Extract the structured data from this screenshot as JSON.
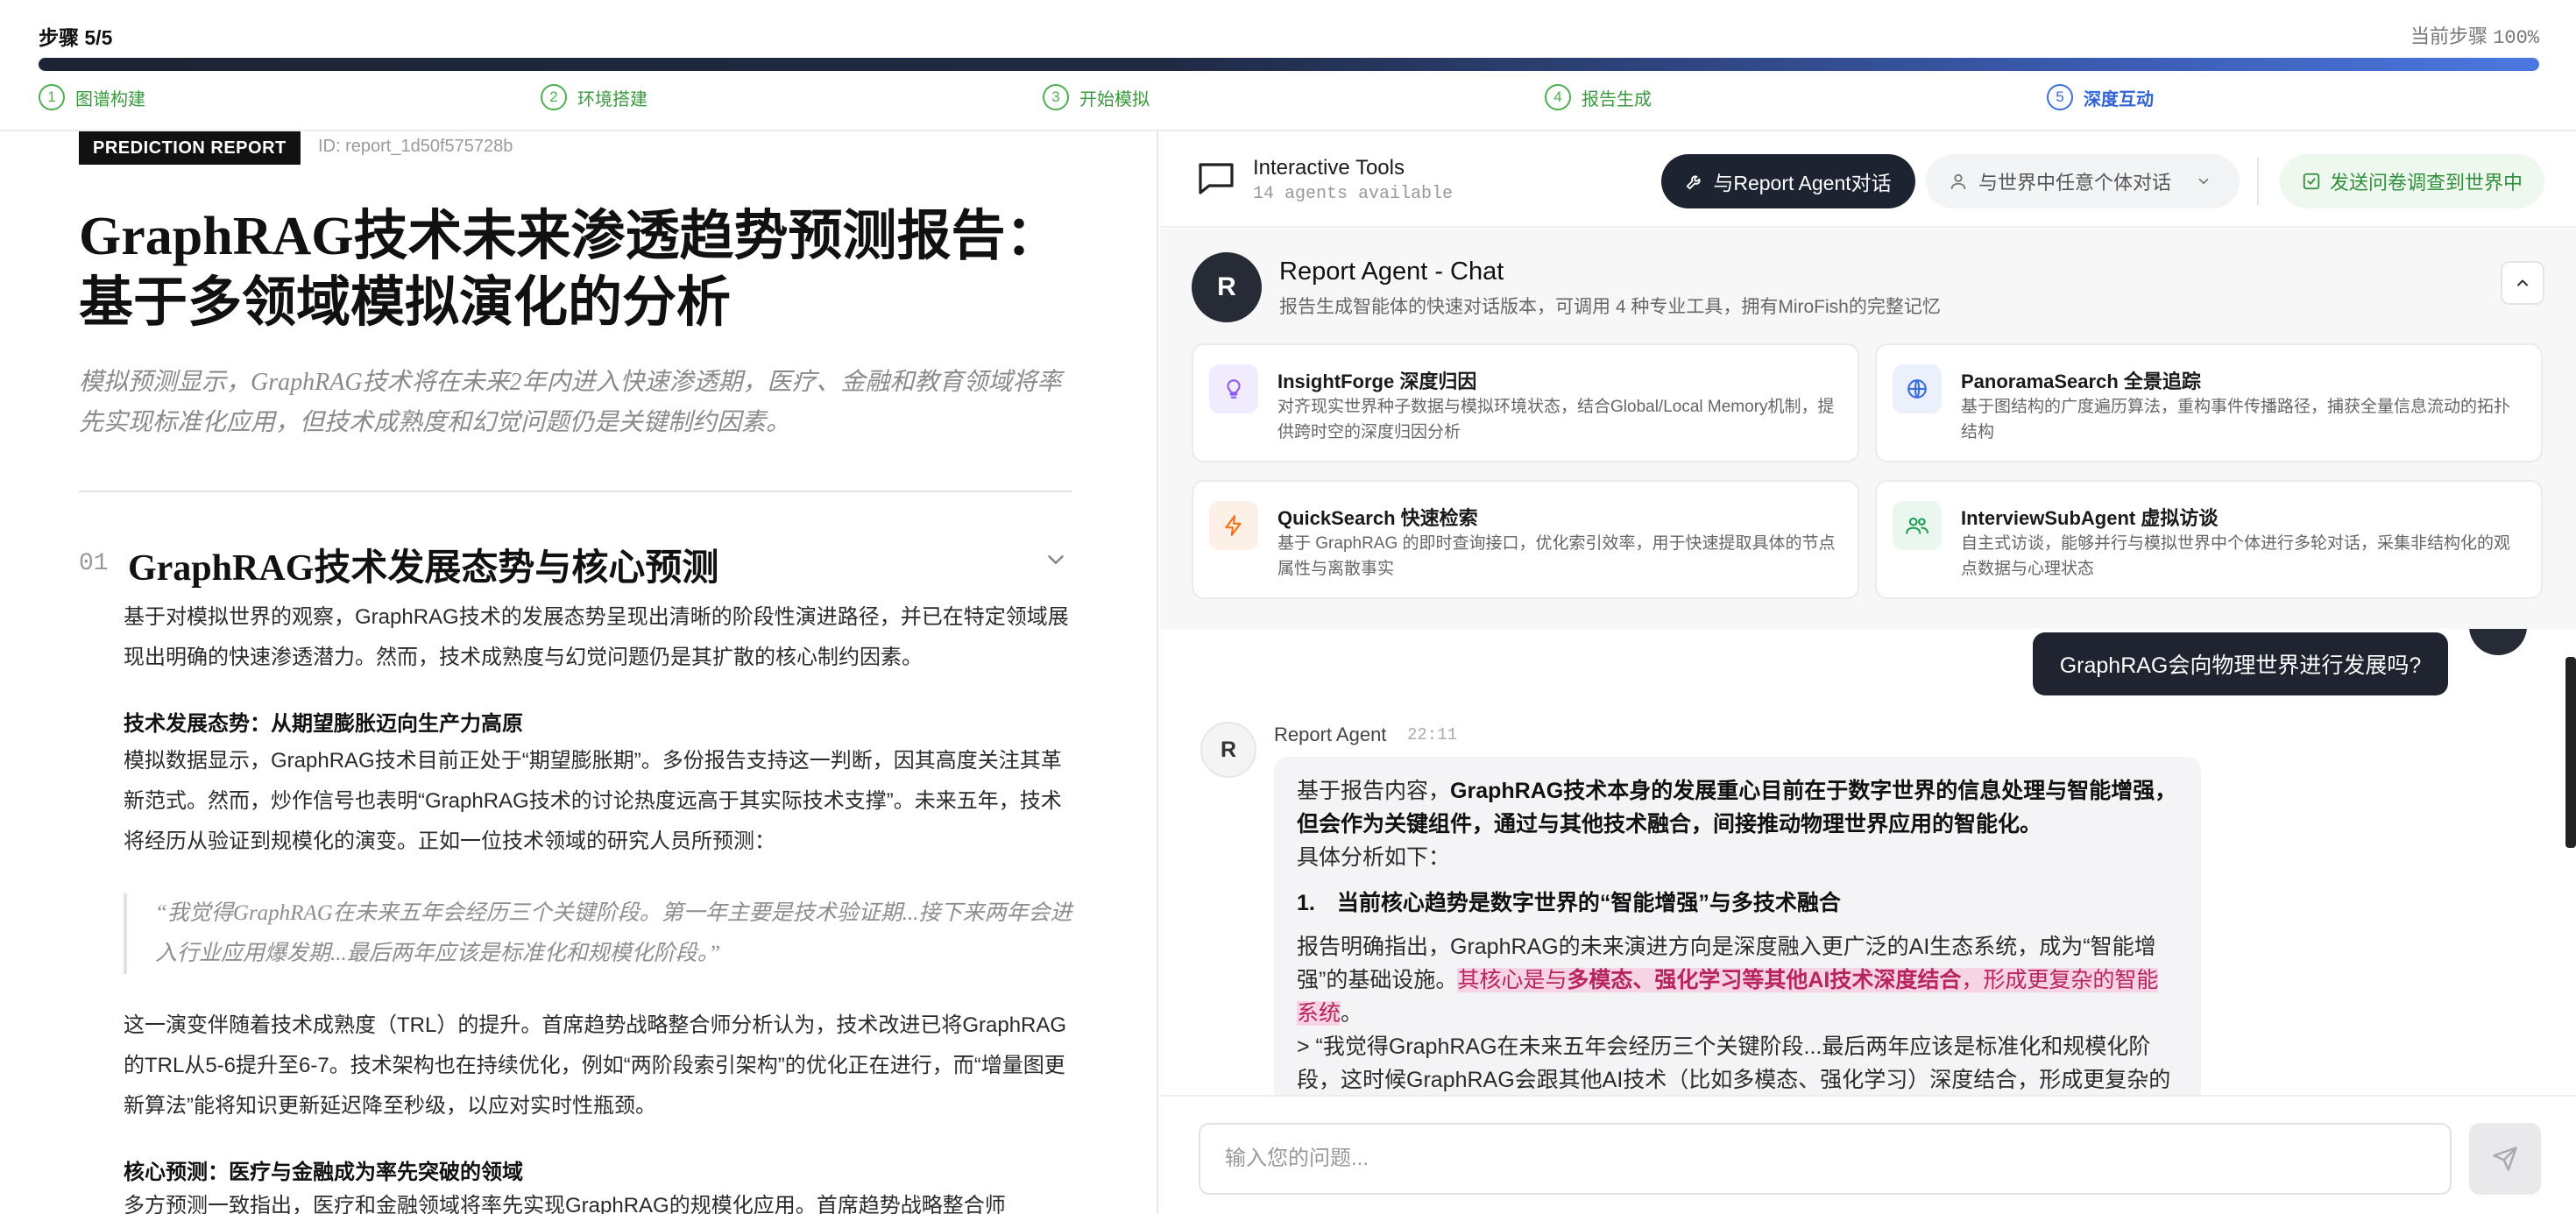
{
  "topbar": {
    "step_title": "步骤 5/5",
    "current_label": "当前步骤",
    "current_pct": "100%",
    "progress": 1.0,
    "steps": [
      {
        "num": "1",
        "label": "图谱构建"
      },
      {
        "num": "2",
        "label": "环境搭建"
      },
      {
        "num": "3",
        "label": "开始模拟"
      },
      {
        "num": "4",
        "label": "报告生成"
      },
      {
        "num": "5",
        "label": "深度互动"
      }
    ]
  },
  "report": {
    "tag": "PREDICTION REPORT",
    "id": "ID: report_1d50f575728b",
    "title": "GraphRAG技术未来渗透趋势预测报告：基于多领域模拟演化的分析",
    "summary": "模拟预测显示，GraphRAG技术将在未来2年内进入快速渗透期，医疗、金融和教育领域将率先实现标准化应用，但技术成熟度和幻觉问题仍是关键制约因素。",
    "section": {
      "num": "01",
      "title": "GraphRAG技术发展态势与核心预测",
      "intro": "基于对模拟世界的观察，GraphRAG技术的发展态势呈现出清晰的阶段性演进路径，并已在特定领域展现出明确的快速渗透潜力。然而，技术成熟度与幻觉问题仍是其扩散的核心制约因素。",
      "sub1": "技术发展态势：从期望膨胀迈向生产力高原",
      "p1": "模拟数据显示，GraphRAG技术目前正处于“期望膨胀期”。多份报告支持这一判断，因其高度关注其革新范式。然而，炒作信号也表明“GraphRAG技术的讨论热度远高于其实际技术支撑”。未来五年，技术将经历从验证到规模化的演变。正如一位技术领域的研究人员所预测：",
      "quote": "“我觉得GraphRAG在未来五年会经历三个关键阶段。第一年主要是技术验证期...接下来两年会进入行业应用爆发期...最后两年应该是标准化和规模化阶段。”",
      "p2": "这一演变伴随着技术成熟度（TRL）的提升。首席趋势战略整合师分析认为，技术改进已将GraphRAG的TRL从5-6提升至6-7。技术架构也在持续优化，例如“两阶段索引架构”的优化正在进行，而“增量图更新算法”能将知识更新延迟降至秒级，以应对实时性瓶颈。",
      "sub2": "核心预测：医疗与金融成为率先突破的领域",
      "p3": "多方预测一致指出，医疗和金融领域将率先实现GraphRAG的规模化应用。首席趋势战略整合师"
    }
  },
  "tools": {
    "title": "Interactive Tools",
    "subtitle": "14 agents available",
    "btn_agent": "与Report Agent对话",
    "btn_world": "与世界中任意个体对话",
    "btn_survey": "发送问卷调查到世界中"
  },
  "agent": {
    "avatar": "R",
    "name": "Report Agent - Chat",
    "desc": "报告生成智能体的快速对话版本，可调用 4 种专业工具，拥有MiroFish的完整记忆",
    "tools": [
      {
        "name": "InsightForge 深度归因",
        "desc": "对齐现实世界种子数据与模拟环境状态，结合Global/Local Memory机制，提供跨时空的深度归因分析",
        "icon": "lightbulb-icon",
        "color": "#8b5cf6"
      },
      {
        "name": "PanoramaSearch 全景追踪",
        "desc": "基于图结构的广度遍历算法，重构事件传播路径，捕获全量信息流动的拓扑结构",
        "icon": "globe-icon",
        "color": "#3b6fe0"
      },
      {
        "name": "QuickSearch 快速检索",
        "desc": "基于 GraphRAG 的即时查询接口，优化索引效率，用于快速提取具体的节点属性与离散事实",
        "icon": "lightning-icon",
        "color": "#f97316"
      },
      {
        "name": "InterviewSubAgent 虚拟访谈",
        "desc": "自主式访谈，能够并行与模拟世界中个体进行多轮对话，采集非结构化的观点数据与心理状态",
        "icon": "users-icon",
        "color": "#22a05a"
      }
    ]
  },
  "chat": {
    "user_message": "GraphRAG会向物理世界进行发展吗?",
    "resp_avatar": "R",
    "resp_name": "Report Agent",
    "resp_time": "22:11",
    "resp_intro_plain": "基于报告内容，",
    "resp_intro_bold": "GraphRAG技术本身的发展重心目前在于数字世界的信息处理与智能增强，但会作为关键组件，通过与其他技术融合，间接推动物理世界应用的智能化。",
    "resp_line2": "具体分析如下：",
    "resp_heading": "1.　当前核心趋势是数字世界的“智能增强”与多技术融合",
    "resp_p1_a": "报告明确指出，GraphRAG的未来演进方向是深度融入更广泛的AI生态系统，成为“智能增强”的基础设施。",
    "resp_p1_hl_a": "其核心是与",
    "resp_p1_hl_b": "多模态、强化学习等其他AI技术深度结合",
    "resp_p1_hl_c": "，形成更复杂的智能系统",
    "resp_p1_end": "。",
    "resp_p2": "> “我觉得GraphRAG在未来五年会经历三个关键阶段...最后两年应该是标准化和规模化阶段，这时候GraphRAG会跟其他AI技术（比如多模态、强化学习）深度结合，形成更复杂的"
  },
  "input": {
    "placeholder": "输入您的问题..."
  }
}
